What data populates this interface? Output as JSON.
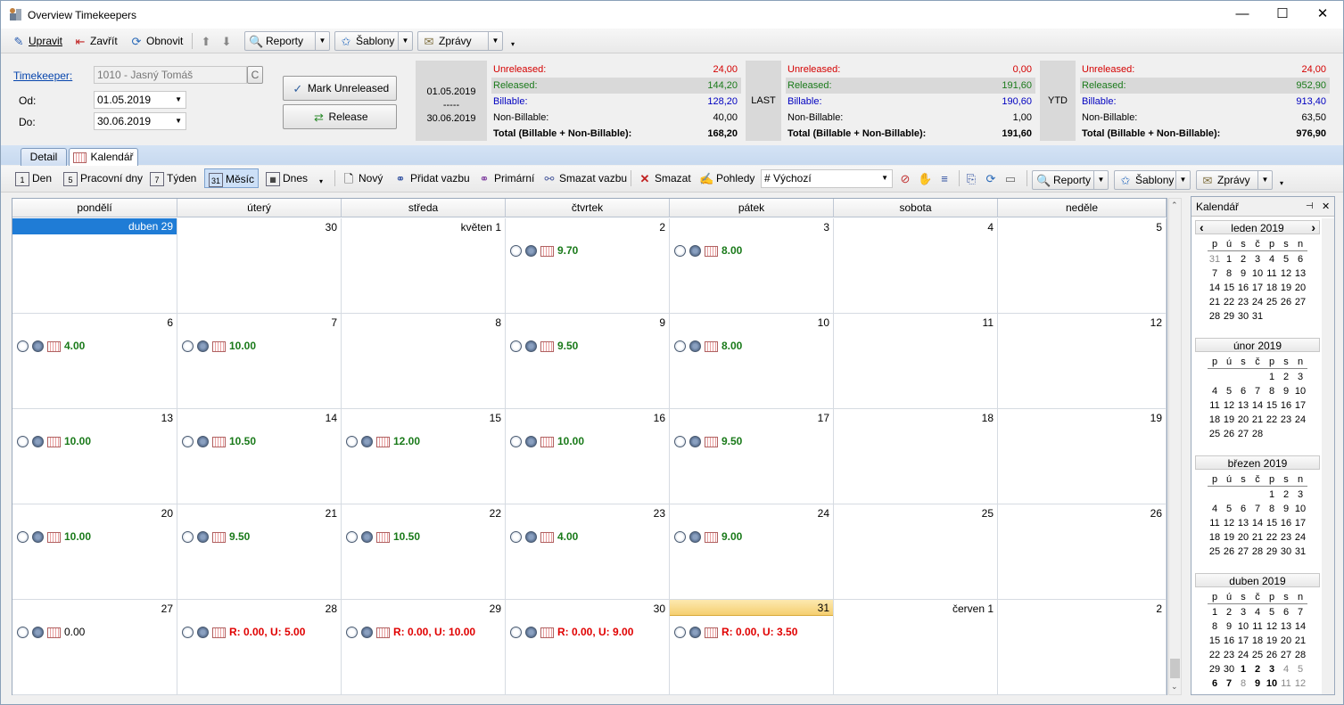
{
  "window": {
    "title": "Overview Timekeepers",
    "min": "—",
    "max": "☐",
    "close": "✕"
  },
  "toolbar1": {
    "edit": "Upravit",
    "close": "Zavřít",
    "refresh": "Obnovit",
    "reports": "Reporty",
    "templates": "Šablony",
    "messages": "Zprávy"
  },
  "filter": {
    "timekeeper_label": "Timekeeper:",
    "timekeeper_value": "1010 - Jasný Tomáš",
    "clear": "C",
    "from_label": "Od:",
    "from_value": "01.05.2019",
    "to_label": "Do:",
    "to_value": "30.06.2019",
    "mark_unreleased": "Mark Unreleased",
    "release": "Release"
  },
  "period": {
    "from": "01.05.2019",
    "dash": "-----",
    "to": "30.06.2019"
  },
  "stats_labels": {
    "unreleased": "Unreleased:",
    "released": "Released:",
    "billable": "Billable:",
    "nonbillable": "Non-Billable:",
    "total": "Total (Billable + Non-Billable):"
  },
  "stats": {
    "period": {
      "unreleased": "24,00",
      "released": "144,20",
      "billable": "128,20",
      "nonbillable": "40,00",
      "total": "168,20"
    },
    "last": {
      "tag": "LAST",
      "unreleased": "0,00",
      "released": "191,60",
      "billable": "190,60",
      "nonbillable": "1,00",
      "total": "191,60"
    },
    "ytd": {
      "tag": "YTD",
      "unreleased": "24,00",
      "released": "952,90",
      "billable": "913,40",
      "nonbillable": "63,50",
      "total": "976,90"
    }
  },
  "tabs": {
    "detail": "Detail",
    "calendar": "Kalendář"
  },
  "toolbar2": {
    "day": "Den",
    "workdays": "Pracovní dny",
    "week": "Týden",
    "month": "Měsíc",
    "today": "Dnes",
    "new": "Nový",
    "add_link": "Přidat vazbu",
    "primary": "Primární",
    "remove_link": "Smazat vazbu",
    "delete": "Smazat",
    "views": "Pohledy",
    "view_value": "# Výchozí",
    "reports": "Reporty",
    "templates": "Šablony",
    "messages": "Zprávy"
  },
  "weekdays": [
    "pondělí",
    "úterý",
    "středa",
    "čtvrtek",
    "pátek",
    "sobota",
    "neděle"
  ],
  "weeks": [
    [
      {
        "d": "duben 29",
        "sel": true
      },
      {
        "d": "30"
      },
      {
        "d": "květen 1"
      },
      {
        "d": "2",
        "v": "9.70",
        "c": "g"
      },
      {
        "d": "3",
        "v": "8.00",
        "c": "g"
      },
      {
        "d": "4"
      },
      {
        "d": "5"
      }
    ],
    [
      {
        "d": "6",
        "v": "4.00",
        "c": "g"
      },
      {
        "d": "7",
        "v": "10.00",
        "c": "g"
      },
      {
        "d": "8"
      },
      {
        "d": "9",
        "v": "9.50",
        "c": "g"
      },
      {
        "d": "10",
        "v": "8.00",
        "c": "g"
      },
      {
        "d": "11"
      },
      {
        "d": "12"
      }
    ],
    [
      {
        "d": "13",
        "v": "10.00",
        "c": "g"
      },
      {
        "d": "14",
        "v": "10.50",
        "c": "g"
      },
      {
        "d": "15",
        "v": "12.00",
        "c": "g"
      },
      {
        "d": "16",
        "v": "10.00",
        "c": "g"
      },
      {
        "d": "17",
        "v": "9.50",
        "c": "g"
      },
      {
        "d": "18"
      },
      {
        "d": "19"
      }
    ],
    [
      {
        "d": "20",
        "v": "10.00",
        "c": "g"
      },
      {
        "d": "21",
        "v": "9.50",
        "c": "g"
      },
      {
        "d": "22",
        "v": "10.50",
        "c": "g"
      },
      {
        "d": "23",
        "v": "4.00",
        "c": "g"
      },
      {
        "d": "24",
        "v": "9.00",
        "c": "g"
      },
      {
        "d": "25"
      },
      {
        "d": "26"
      }
    ],
    [
      {
        "d": "27",
        "v": "0.00",
        "c": "k"
      },
      {
        "d": "28",
        "v": "R: 0.00, U: 5.00",
        "c": "r"
      },
      {
        "d": "29",
        "v": "R: 0.00, U: 10.00",
        "c": "r"
      },
      {
        "d": "30",
        "v": "R: 0.00, U: 9.00",
        "c": "r"
      },
      {
        "d": "31",
        "v": "R: 0.00, U: 3.50",
        "c": "r",
        "today": true
      },
      {
        "d": "červen 1"
      },
      {
        "d": "2"
      }
    ]
  ],
  "side": {
    "title": "Kalendář",
    "dow": [
      "p",
      "ú",
      "s",
      "č",
      "p",
      "s",
      "n"
    ],
    "months": [
      {
        "name": "leden 2019",
        "rows": [
          [
            "31",
            "1",
            "2",
            "3",
            "4",
            "5",
            "6"
          ],
          [
            "7",
            "8",
            "9",
            "10",
            "11",
            "12",
            "13"
          ],
          [
            "14",
            "15",
            "16",
            "17",
            "18",
            "19",
            "20"
          ],
          [
            "21",
            "22",
            "23",
            "24",
            "25",
            "26",
            "27"
          ],
          [
            "28",
            "29",
            "30",
            "31",
            "",
            "",
            ""
          ]
        ]
      },
      {
        "name": "únor 2019",
        "rows": [
          [
            "",
            "",
            "",
            "",
            "1",
            "2",
            "3"
          ],
          [
            "4",
            "5",
            "6",
            "7",
            "8",
            "9",
            "10"
          ],
          [
            "11",
            "12",
            "13",
            "14",
            "15",
            "16",
            "17"
          ],
          [
            "18",
            "19",
            "20",
            "21",
            "22",
            "23",
            "24"
          ],
          [
            "25",
            "26",
            "27",
            "28",
            "",
            "",
            ""
          ]
        ]
      },
      {
        "name": "březen 2019",
        "rows": [
          [
            "",
            "",
            "",
            "",
            "1",
            "2",
            "3"
          ],
          [
            "4",
            "5",
            "6",
            "7",
            "8",
            "9",
            "10"
          ],
          [
            "11",
            "12",
            "13",
            "14",
            "15",
            "16",
            "17"
          ],
          [
            "18",
            "19",
            "20",
            "21",
            "22",
            "23",
            "24"
          ],
          [
            "25",
            "26",
            "27",
            "28",
            "29",
            "30",
            "31"
          ]
        ]
      },
      {
        "name": "duben 2019",
        "rows": [
          [
            "1",
            "2",
            "3",
            "4",
            "5",
            "6",
            "7"
          ],
          [
            "8",
            "9",
            "10",
            "11",
            "12",
            "13",
            "14"
          ],
          [
            "15",
            "16",
            "17",
            "18",
            "19",
            "20",
            "21"
          ],
          [
            "22",
            "23",
            "24",
            "25",
            "26",
            "27",
            "28"
          ],
          [
            "29",
            "30",
            "1",
            "2",
            "3",
            "4",
            "5"
          ],
          [
            "6",
            "7",
            "8",
            "9",
            "10",
            "11",
            "12"
          ]
        ]
      }
    ]
  },
  "colors": {
    "unreleased": "#d40000",
    "released": "#1a7a1a",
    "billable": "#0000c0",
    "accent": "#1f7cd6"
  }
}
